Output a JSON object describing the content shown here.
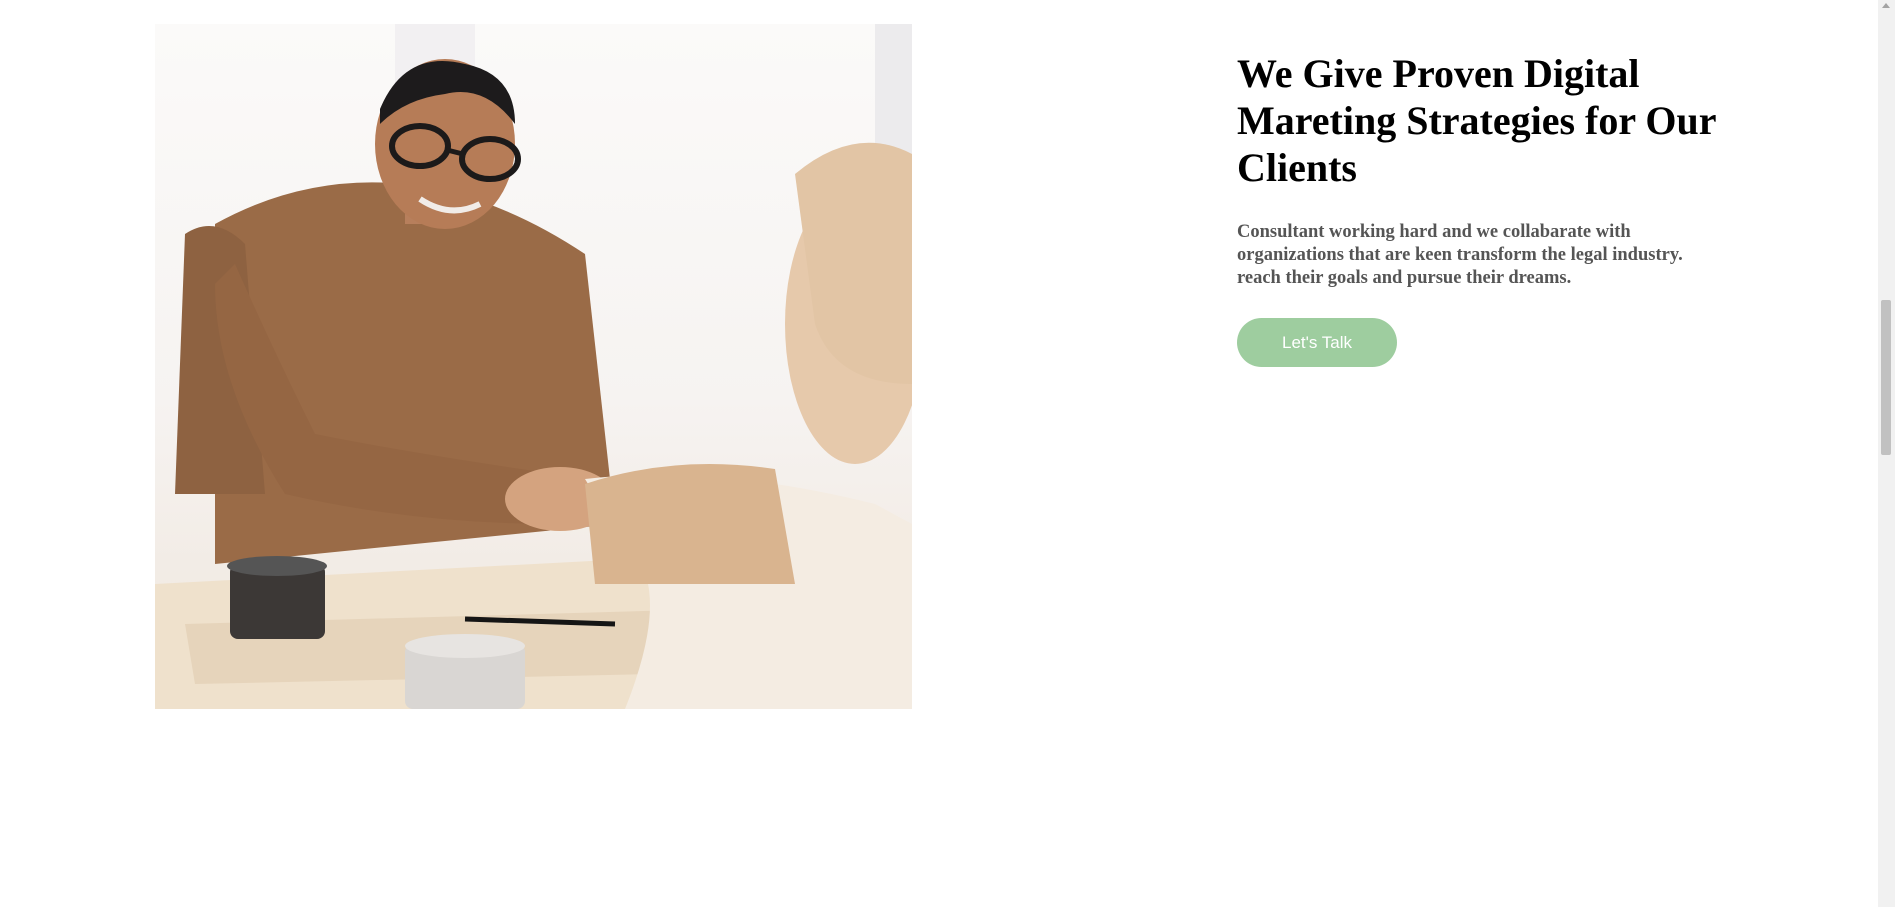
{
  "hero": {
    "image_alt": "Two people shaking hands across a table",
    "headline": "We Give Proven Digital Mareting Strategies for Our Clients",
    "description": "Consultant working hard and we collabarate with organizations that are keen transform the legal industry. reach their goals and pursue their dreams.",
    "cta_label": "Let's Talk"
  },
  "colors": {
    "cta_background": "#9ecd9f",
    "cta_text": "#ffffff",
    "headline": "#000000",
    "description": "#555555"
  }
}
